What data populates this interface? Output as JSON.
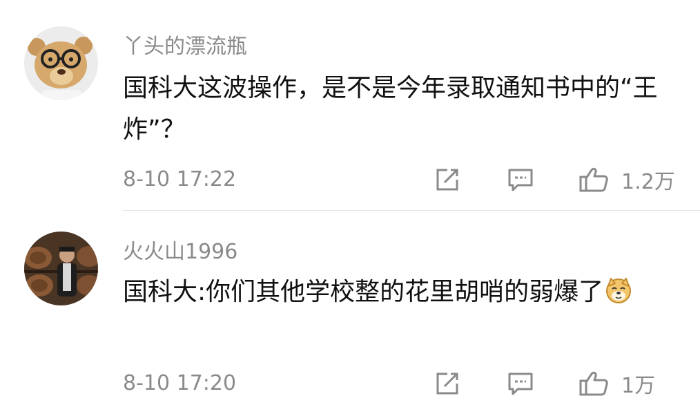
{
  "comments": [
    {
      "username": "丫头的漂流瓶",
      "text": "国科大这波操作，是不是今年录取通知书中的“王炸”？",
      "time": "8-10 17:22",
      "likes": "1.2万",
      "avatar_icon": "teddy-bear-with-glasses"
    },
    {
      "username": "火火山1996",
      "text": "国科大:你们其他学校整的花里胡哨的弱爆了",
      "time": "8-10 17:20",
      "likes": "1万",
      "avatar_icon": "person-with-barrels"
    }
  ],
  "icons": {
    "share": "share-icon",
    "reply": "comment-icon",
    "like": "thumbs-up-icon",
    "emoji": "doge-emoji-icon"
  },
  "colors": {
    "meta_text": "#8a8a8a",
    "body_text": "#111111",
    "divider": "#e6e6e6"
  }
}
